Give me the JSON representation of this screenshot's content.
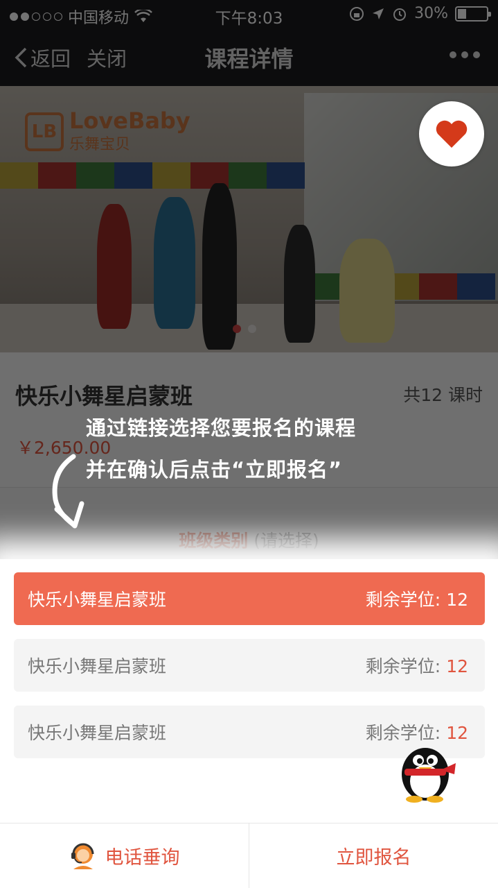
{
  "status_bar": {
    "carrier": "中国移动",
    "time": "下午8:03",
    "battery": "30%"
  },
  "nav": {
    "back_label": "返回",
    "close_label": "关闭",
    "title": "课程详情"
  },
  "banner": {
    "brand_name": "LoveBaby",
    "brand_sub": "乐舞宝贝"
  },
  "course": {
    "title": "快乐小舞星启蒙班",
    "lessons": "共12 课时",
    "price": "￥2,650.00"
  },
  "class_section": {
    "label": "班级类别",
    "hint": "(请选择)"
  },
  "options": [
    {
      "name": "快乐小舞星启蒙班",
      "seats_label": "剩余学位:",
      "seats": "12",
      "selected": true
    },
    {
      "name": "快乐小舞星启蒙班",
      "seats_label": "剩余学位:",
      "seats": "12",
      "selected": false
    },
    {
      "name": "快乐小舞星启蒙班",
      "seats_label": "剩余学位:",
      "seats": "12",
      "selected": false
    }
  ],
  "bottom_bar": {
    "phone_label": "电话垂询",
    "enroll_label": "立即报名"
  },
  "annotation": {
    "line1": "通过链接选择您要报名的课程",
    "line2": "并在确认后点击“立即报名”"
  },
  "colors": {
    "accent": "#ef6a51",
    "price": "#e0553f"
  }
}
